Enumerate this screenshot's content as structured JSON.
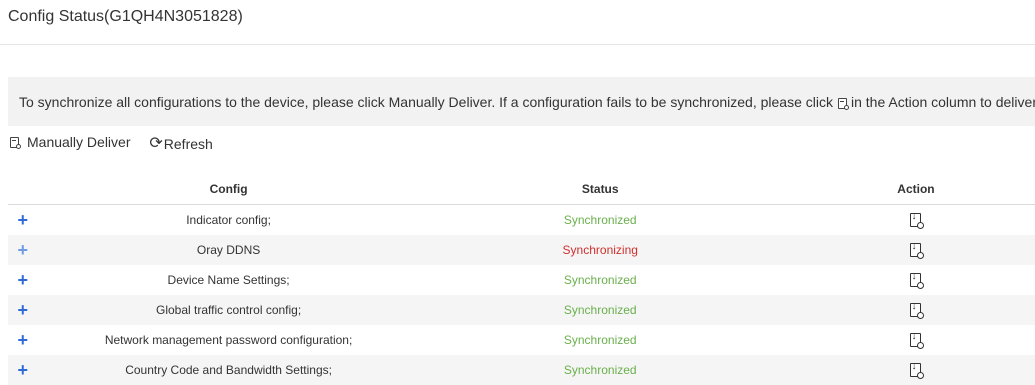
{
  "header": {
    "title": "Config Status(G1QH4N3051828)"
  },
  "notice": {
    "text_before": "To synchronize all configurations to the device, please click Manually Deliver. If a configuration fails to be synchronized, please click",
    "text_after": "in the Action column to deliver"
  },
  "toolbar": {
    "deliver_label": "Manually Deliver",
    "refresh_label": "Refresh"
  },
  "table": {
    "headers": {
      "config": "Config",
      "status": "Status",
      "action": "Action"
    },
    "rows": [
      {
        "expand": "+",
        "config": "Indicator config;",
        "status": "Synchronized",
        "state": "ok"
      },
      {
        "expand": "+",
        "config": "Oray DDNS",
        "status": "Synchronizing",
        "state": "busy"
      },
      {
        "expand": "+",
        "config": "Device Name Settings;",
        "status": "Synchronized",
        "state": "ok"
      },
      {
        "expand": "+",
        "config": "Global traffic control config;",
        "status": "Synchronized",
        "state": "ok"
      },
      {
        "expand": "+",
        "config": "Network management password configuration;",
        "status": "Synchronized",
        "state": "ok"
      },
      {
        "expand": "+",
        "config": "Country Code and Bandwidth Settings;",
        "status": "Synchronized",
        "state": "ok"
      }
    ]
  },
  "colors": {
    "ok": "#6ab04c",
    "busy": "#d0302d",
    "expand": "#2e6bd6"
  }
}
